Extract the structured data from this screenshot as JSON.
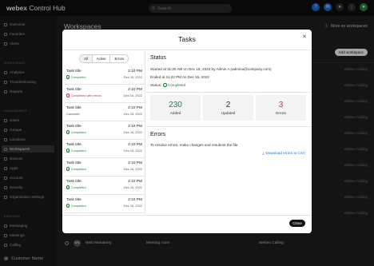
{
  "app": {
    "brand_bold": "webex",
    "brand_rest": " Control Hub",
    "search_placeholder": "Search"
  },
  "topbar": {
    "icons": [
      "help-icon",
      "chat-icon",
      "alert-icon",
      "apps-icon",
      "user-icon"
    ]
  },
  "sidebar": {
    "items_top": [
      "Overview",
      "Favorites",
      "Alerts"
    ],
    "section_monitoring": "MONITORING",
    "items_monitoring": [
      "Analytics",
      "Troubleshooting",
      "Reports"
    ],
    "section_management": "MANAGEMENT",
    "items_management": [
      "Users",
      "Groups",
      "Locations",
      "Workspaces",
      "Devices",
      "Apps",
      "Account",
      "Security",
      "Organization settings"
    ],
    "section_services": "SERVICES",
    "items_services": [
      "Messaging",
      "Meetings",
      "Calling"
    ],
    "footer": "Customer Name"
  },
  "main": {
    "title": "Workspaces",
    "more_workspaces": "More on workspaces",
    "add_workspace": "Add workspace",
    "bg_cells": [
      "Webex Calling",
      "Webex Calling",
      "Webex Calling",
      "Webex Calling",
      "Webex Calling",
      "Webex Calling",
      "Webex Calling",
      "Webex Calling",
      "Webex Calling",
      "Webex Calling"
    ],
    "bottom_row": {
      "initials": "WM",
      "name": "Web Manabory",
      "type": "Meeting room",
      "calling": "Webex Calling"
    }
  },
  "modal": {
    "title": "Tasks",
    "close_label": "Close",
    "filters": [
      "All",
      "Active",
      "Errors"
    ],
    "tasks": [
      {
        "name": "Task title",
        "status": "Completed",
        "status_type": "completed",
        "time": "2:10 PM",
        "date": "Dec 15, 2022"
      },
      {
        "name": "Task title",
        "status": "Completed with errors",
        "status_type": "errors",
        "time": "2:10 PM",
        "date": "Dec 15, 2022"
      },
      {
        "name": "Task title",
        "status": "Canceled",
        "status_type": "canceled",
        "time": "2:10 PM",
        "date": "Dec 15, 2022"
      },
      {
        "name": "Task title",
        "status": "Completed",
        "status_type": "completed",
        "time": "2:10 PM",
        "date": "Dec 15, 2022"
      },
      {
        "name": "Task title",
        "status": "Completed",
        "status_type": "completed",
        "time": "2:10 PM",
        "date": "Dec 15, 2022"
      },
      {
        "name": "Task title",
        "status": "Completed",
        "status_type": "completed",
        "time": "2:10 PM",
        "date": "Dec 15, 2022"
      },
      {
        "name": "Task title",
        "status": "Completed",
        "status_type": "completed",
        "time": "2:10 PM",
        "date": "Dec 15, 2022"
      },
      {
        "name": "Task title",
        "status": "Completed",
        "status_type": "completed",
        "time": "2:10 PM",
        "date": "Dec 15, 2022"
      }
    ],
    "status": {
      "heading": "Status",
      "started": "Started at 11:20 AM on Dec 15, 2022 by Admin A (admina@company.com)",
      "ended": "Ended at 11:22 PM on Dec 15, 2022",
      "status_label": "Status:",
      "status_value": "Completed",
      "cards": [
        {
          "num": "230",
          "label": "Added",
          "color": "#1e7d5a"
        },
        {
          "num": "2",
          "label": "Updated",
          "color": "#333333"
        },
        {
          "num": "3",
          "label": "Errors",
          "color": "#c0314a"
        }
      ]
    },
    "errors": {
      "heading": "Errors",
      "text": "To resolve errors, make changes and resubmit the file.",
      "download": "Download errors to CSV"
    }
  }
}
